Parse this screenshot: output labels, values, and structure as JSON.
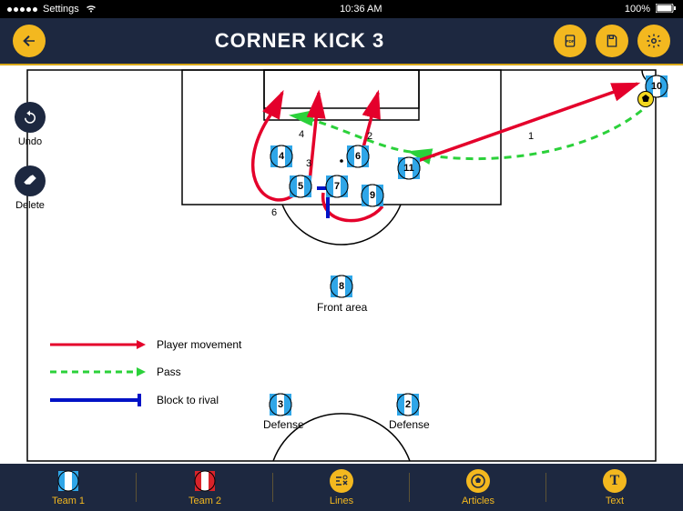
{
  "status": {
    "settings": "Settings",
    "time": "10:36 AM",
    "battery": "100%"
  },
  "header": {
    "title": "CORNER KICK 3"
  },
  "tools": {
    "undo": "Undo",
    "delete": "Delete"
  },
  "legend": {
    "movement": "Player movement",
    "pass": "Pass",
    "block": "Block to rival"
  },
  "labels": {
    "front": "Front area",
    "defenseL": "Defense",
    "defenseR": "Defense"
  },
  "pathNums": {
    "n1": "1",
    "n2": "2",
    "n3": "3",
    "n4": "4",
    "n6": "6"
  },
  "players": {
    "p2": "2",
    "p3": "3",
    "p4": "4",
    "p5": "5",
    "p6": "6",
    "p7": "7",
    "p8": "8",
    "p9": "9",
    "p10": "10",
    "p11": "11"
  },
  "bottom": {
    "team1": "Team 1",
    "team2": "Team 2",
    "lines": "Lines",
    "articles": "Articles",
    "text": "Text"
  }
}
